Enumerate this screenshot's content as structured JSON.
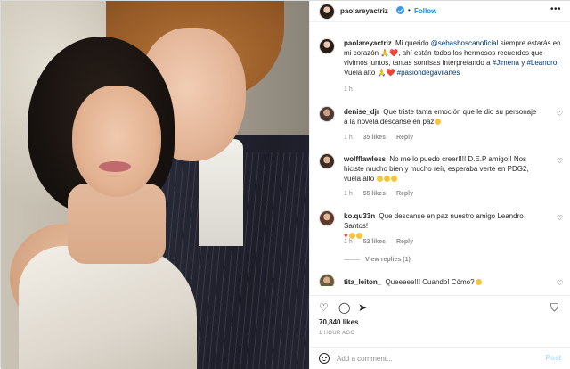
{
  "author": {
    "username": "paolareyactriz",
    "follow_label": "Follow",
    "separator": "•",
    "more_label": "•••"
  },
  "caption": {
    "username": "paolareyactriz",
    "text_1": "Mi querido ",
    "mention": "@sebasboscanoficial",
    "text_2": " siempre estarás en mi corazón 🙏❤️, ahí están todos los hermosos recuerdos que vivimos juntos, tantas sonrisas interpretando a ",
    "hashtag_1": "#Jimena",
    "text_3": " y ",
    "hashtag_2": "#Leandro",
    "text_4": "! Vuela alto 🙏❤️ ",
    "hashtag_3": "#pasiondegavilanes",
    "time": "1 h"
  },
  "comments": [
    {
      "username": "denise_djr",
      "text": "Que triste tanta emoción que le dio su personaje a la novela descanse en paz",
      "time": "1 h",
      "likes": "35 likes",
      "reply": "Reply"
    },
    {
      "username": "wolfflawless",
      "text": "No me lo puedo creer!!!! D.E.P amigo!! Nos hiciste mucho bien y mucho reír, esperaba verte en PDG2, vuela alto",
      "time": "1 h",
      "likes": "55 likes",
      "reply": "Reply"
    },
    {
      "username": "ko.qu33n",
      "text": "Que descanse en paz nuestro amigo Leandro Santos!",
      "time": "1 h",
      "likes": "52 likes",
      "reply": "Reply",
      "view_replies": "View replies (1)"
    },
    {
      "username": "tita_leiton_",
      "text": "Queeeee!!! Cuando! Cómo?"
    }
  ],
  "stats": {
    "likes": "70,840 likes",
    "time_ago": "1 HOUR AGO"
  },
  "add_comment": {
    "placeholder": "Add a comment...",
    "post_label": "Post"
  },
  "colors": {
    "accent": "#0095f6",
    "verified": "#3897f0",
    "text": "#262626",
    "muted": "#8e8e8e",
    "border": "#dbdbdb"
  }
}
